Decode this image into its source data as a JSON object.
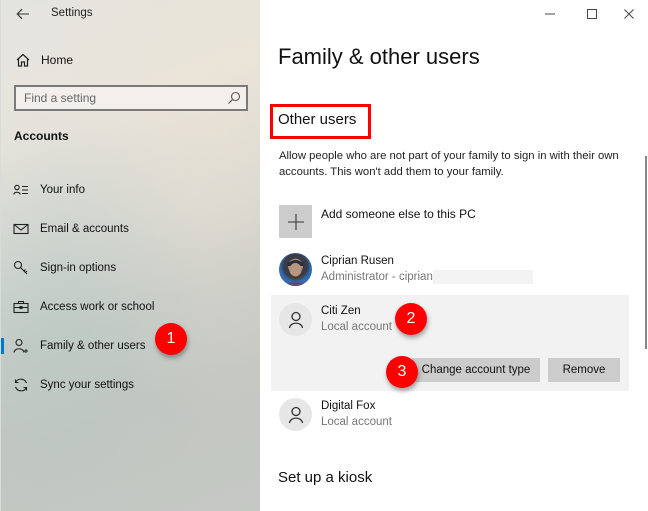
{
  "window": {
    "app_title": "Settings",
    "controls": {
      "minimize": "minimize-icon",
      "maximize": "maximize-icon",
      "close": "close-icon"
    }
  },
  "sidebar": {
    "back_icon": "back-arrow-icon",
    "home_label": "Home",
    "search": {
      "placeholder": "Find a setting",
      "value": ""
    },
    "section_label": "Accounts",
    "items": [
      {
        "label": "Your info",
        "icon": "contact-card-icon",
        "active": false
      },
      {
        "label": "Email & accounts",
        "icon": "mail-icon",
        "active": false
      },
      {
        "label": "Sign-in options",
        "icon": "key-icon",
        "active": false
      },
      {
        "label": "Access work or school",
        "icon": "briefcase-icon",
        "active": false
      },
      {
        "label": "Family & other users",
        "icon": "add-person-icon",
        "active": true
      },
      {
        "label": "Sync your settings",
        "icon": "sync-icon",
        "active": false
      }
    ]
  },
  "main": {
    "page_title": "Family & other users",
    "section_title": "Other users",
    "description": "Allow people who are not part of your family to sign in with their own accounts. This won't add them to your family.",
    "add_user_label": "Add someone else to this PC",
    "users": [
      {
        "name": "Ciprian Rusen",
        "subtitle": "Administrator - ciprian",
        "avatar": "photo"
      },
      {
        "name": "Citi Zen",
        "subtitle": "Local account",
        "avatar": "person-icon",
        "selected": true
      },
      {
        "name": "Digital Fox",
        "subtitle": "Local account",
        "avatar": "person-icon"
      }
    ],
    "buttons": {
      "change_type": "Change account type",
      "remove": "Remove"
    },
    "kiosk_title": "Set up a kiosk"
  },
  "annotations": {
    "step1": "1",
    "step2": "2",
    "step3": "3",
    "highlight_color": "#ff0000"
  },
  "accent_color": "#0078d7"
}
